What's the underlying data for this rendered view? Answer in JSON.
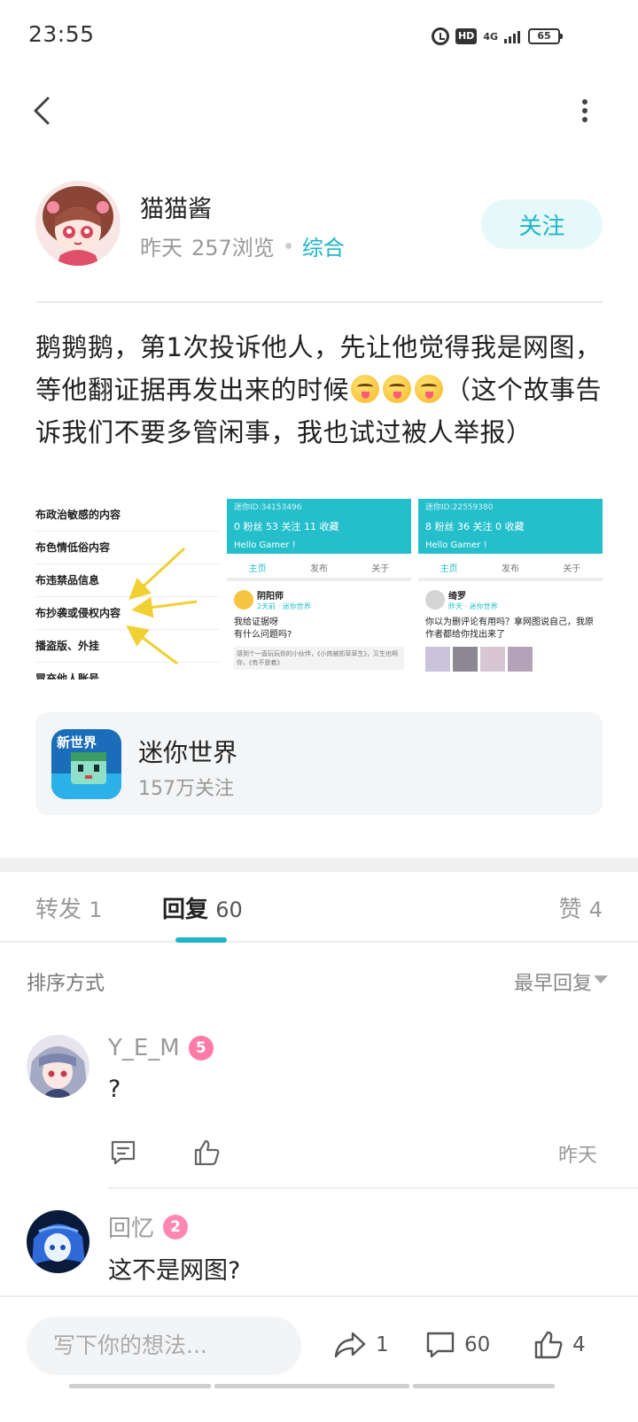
{
  "status_bar": {
    "time": "23:55",
    "hd": "HD",
    "network": "4G",
    "battery": "65"
  },
  "post": {
    "author_name": "猫猫酱",
    "time": "昨天",
    "views": "257浏览",
    "topic": "综合",
    "follow_label": "关注",
    "text_part1": "鹅鹅鹅，第1次投诉他人，先让他觉得我是网图，等他翻证据再发出来的时候",
    "text_part2": "（这个故事告诉我们不要多管闲事，我也试过被人举报）",
    "emoji_count": 3
  },
  "images": {
    "report_reasons": [
      "布政治敏感的内容",
      "布色情低俗内容",
      "布违禁品信息",
      "布抄袭或侵权内容",
      "播盗版、外挂",
      "冒充他人账号"
    ],
    "profile_a": {
      "id": "迷你ID:34153496",
      "stats": "0 粉丝   53 关注   11 收藏",
      "hello": "Hello Gamer !",
      "tabs": [
        "主页",
        "发布",
        "关于"
      ],
      "user": "阴阳师",
      "sub": "2天前 · 迷你世界",
      "line1": "我给证据呀",
      "line2": "有什么问题吗?",
      "quote": "感到个一直玩玩你的小伙伴，《小肉被抓草草生》，又生也啊你，《有不是着》"
    },
    "profile_b": {
      "id": "迷你ID:22559380",
      "stats": "8 粉丝   36 关注   0 收藏",
      "hello": "Hello Gamer !",
      "tabs": [
        "主页",
        "发布",
        "关于"
      ],
      "user": "绮罗",
      "sub": "昨天 · 迷你世界",
      "line": "你以为删评论有用吗？拿网图说自己，我原作者都给你找出来了"
    }
  },
  "game_card": {
    "name": "迷你世界",
    "followers": "157万关注",
    "icon_text": "新世界"
  },
  "tabs": {
    "repost_label": "转发",
    "repost_count": "1",
    "reply_label": "回复",
    "reply_count": "60",
    "like_label": "赞",
    "like_count": "4"
  },
  "sort": {
    "label": "排序方式",
    "value": "最早回复"
  },
  "comments": [
    {
      "name": "Y_E_M",
      "level": "5",
      "text": "?",
      "time": "昨天"
    },
    {
      "name": "回忆",
      "level": "2",
      "text": "这不是网图?"
    }
  ],
  "bottom_bar": {
    "input_placeholder": "写下你的想法...",
    "share_count": "1",
    "comment_count": "60",
    "like_count": "4"
  },
  "colors": {
    "accent": "#1fb5c9",
    "level_badge": "#ff7ba5",
    "profile_header": "#25bfcc"
  }
}
